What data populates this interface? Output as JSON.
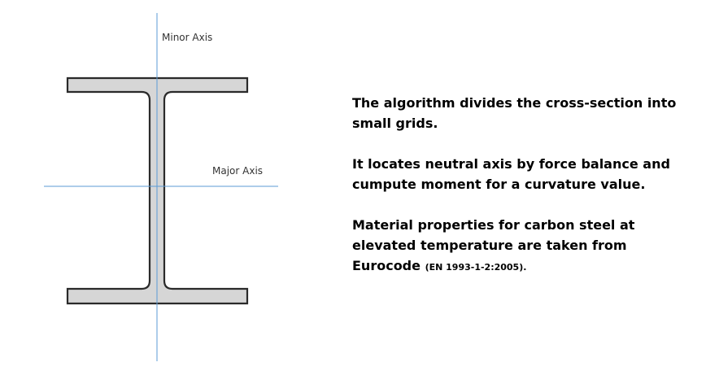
{
  "diagram": {
    "minor_axis_label": "Minor Axis",
    "major_axis_label": "Major Axis",
    "colors": {
      "section_fill": "#d6d6d6",
      "section_stroke": "#2a2a2a",
      "axis_line": "#5b9bd5"
    }
  },
  "text": {
    "paragraph_1": "The algorithm divides the cross-section into small grids.",
    "paragraph_2": "It locates neutral axis by force balance and cumpute moment for a curvature value.",
    "paragraph_3": "Material properties for carbon steel at elevated temperature are taken from Eurocode",
    "paragraph_3_ref": "(EN 1993-1-2:2005)."
  }
}
